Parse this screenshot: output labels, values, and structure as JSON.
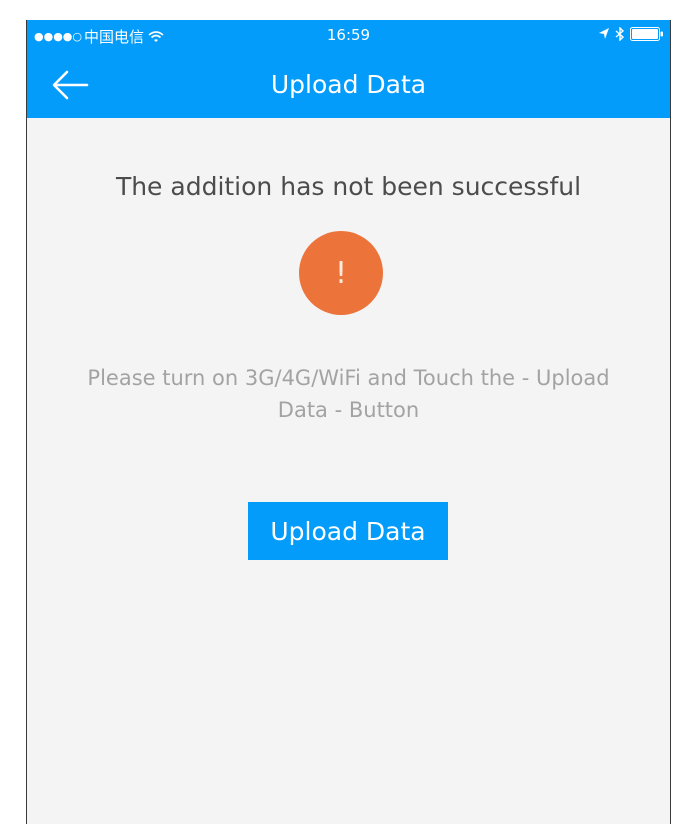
{
  "status_bar": {
    "signal": "●●●●○",
    "carrier": "中国电信",
    "time": "16:59"
  },
  "nav": {
    "title": "Upload Data"
  },
  "message": "The addition has not been successful",
  "alert_symbol": "!",
  "instruction": "Please turn on 3G/4G/WiFi and Touch the - Upload Data - Button",
  "upload_button_label": "Upload Data",
  "colors": {
    "accent": "#039cfa",
    "alert": "#ec733a",
    "background": "#f4f4f4"
  },
  "icons": [
    "back-arrow-icon",
    "wifi-icon",
    "location-icon",
    "bluetooth-icon",
    "battery-icon"
  ]
}
